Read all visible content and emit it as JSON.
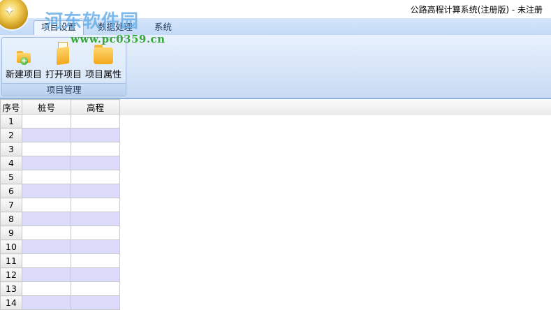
{
  "window": {
    "title": "公路高程计算系统(注册版) - 未注册",
    "watermark_text": "河东软件园",
    "watermark_url": "www.pc0359.cn"
  },
  "tabs": [
    {
      "label": "项目设置",
      "active": true
    },
    {
      "label": "数据处理",
      "active": false
    },
    {
      "label": "系统",
      "active": false
    }
  ],
  "ribbon": {
    "group_label": "项目管理",
    "buttons": [
      {
        "label": "新建项目",
        "icon": "new-folder-icon"
      },
      {
        "label": "打开项目",
        "icon": "open-folder-icon"
      },
      {
        "label": "项目属性",
        "icon": "folder-properties-icon"
      }
    ]
  },
  "grid": {
    "columns": [
      "序号",
      "桩号",
      "高程"
    ],
    "row_numbers": [
      "1",
      "2",
      "3",
      "4",
      "5",
      "6",
      "7",
      "8",
      "9",
      "10",
      "11",
      "12",
      "13",
      "14"
    ]
  },
  "colors": {
    "tab_bar": "#c3daf6",
    "alt_row": "#dcdcfa",
    "accent_border": "#8fb1dd"
  }
}
